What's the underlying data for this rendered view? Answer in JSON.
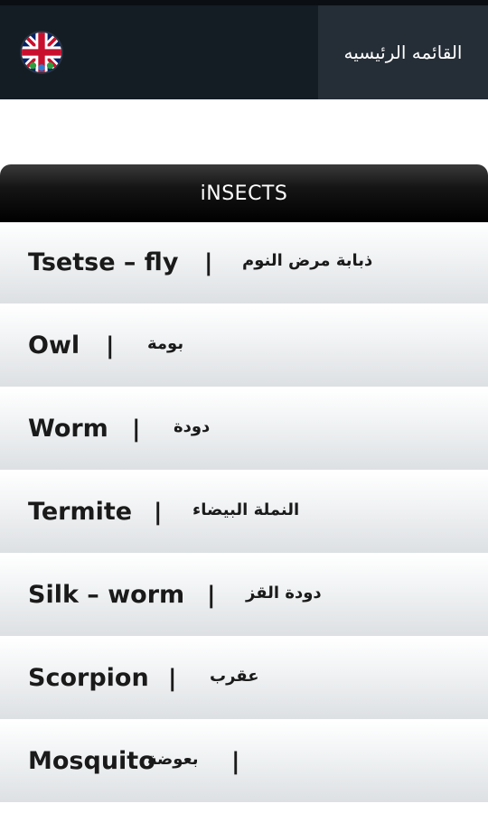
{
  "header": {
    "menu_label": "القائمه الرئيسيه",
    "language_icon": "uk-flag-icon"
  },
  "section": {
    "title": "iNSECTS"
  },
  "separator": "|",
  "items": [
    {
      "english": "Tsetse – fly",
      "arabic": "ذبابة مرض النوم"
    },
    {
      "english": "Owl",
      "arabic": "بومة"
    },
    {
      "english": "Worm",
      "arabic": "دودة"
    },
    {
      "english": "Termite",
      "arabic": "النملة البيضاء"
    },
    {
      "english": "Silk – worm",
      "arabic": "دودة القز"
    },
    {
      "english": "Scorpion",
      "arabic": "عقرب"
    },
    {
      "english": "Mosquito",
      "arabic": "بعوضة"
    }
  ]
}
